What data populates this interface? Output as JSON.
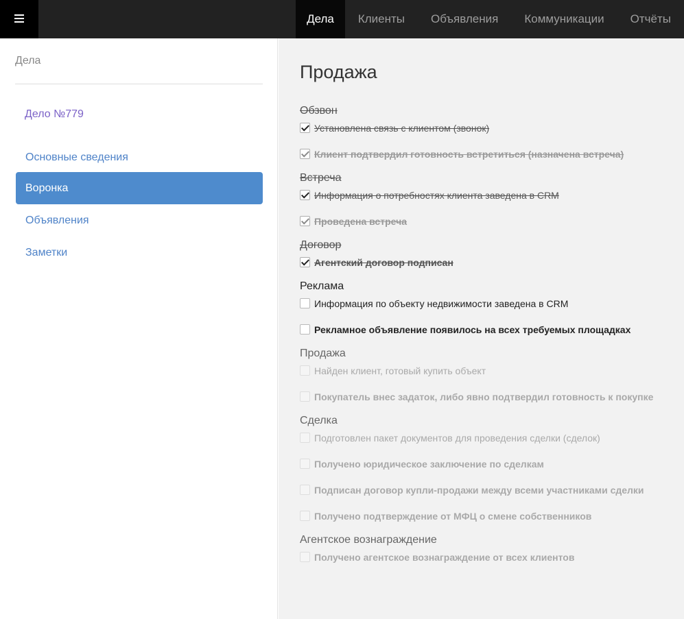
{
  "topbar": {
    "nav": [
      {
        "label": "Дела",
        "active": true
      },
      {
        "label": "Клиенты",
        "active": false
      },
      {
        "label": "Объявления",
        "active": false
      },
      {
        "label": "Коммуникации",
        "active": false
      },
      {
        "label": "Отчёты",
        "active": false
      }
    ]
  },
  "sidebar": {
    "header": "Дела",
    "case_link": "Дело №779",
    "items": [
      {
        "label": "Основные сведения",
        "active": false
      },
      {
        "label": "Воронка",
        "active": true
      },
      {
        "label": "Объявления",
        "active": false
      },
      {
        "label": "Заметки",
        "active": false
      }
    ]
  },
  "main": {
    "title": "Продажа",
    "stages": [
      {
        "title": "Обзвон",
        "state": "done",
        "tasks": [
          {
            "label": "Установлена связь с клиентом (звонок)",
            "checked": true,
            "bold": false,
            "soft": false
          },
          {
            "label": "Клиент подтвердил готовность встретиться (назначена встреча)",
            "checked": true,
            "bold": true,
            "soft": true
          }
        ]
      },
      {
        "title": "Встреча",
        "state": "done",
        "tasks": [
          {
            "label": "Информация о потребностях клиента заведена в CRM",
            "checked": true,
            "bold": false,
            "soft": false
          },
          {
            "label": "Проведена встреча",
            "checked": true,
            "bold": true,
            "soft": true
          }
        ]
      },
      {
        "title": "Договор",
        "state": "done",
        "tasks": [
          {
            "label": "Агентский договор подписан",
            "checked": true,
            "bold": true,
            "soft": false
          }
        ]
      },
      {
        "title": "Реклама",
        "state": "current",
        "tasks": [
          {
            "label": "Информация по объекту недвижимости заведена в CRM",
            "checked": false,
            "bold": false,
            "soft": false
          },
          {
            "label": "Рекламное объявление появилось на всех требуемых площадках",
            "checked": false,
            "bold": true,
            "soft": false
          }
        ]
      },
      {
        "title": "Продажа",
        "state": "future",
        "tasks": [
          {
            "label": "Найден клиент, готовый купить объект",
            "checked": false,
            "bold": false,
            "soft": false
          },
          {
            "label": "Покупатель внес задаток, либо явно подтвердил готовность к покупке",
            "checked": false,
            "bold": true,
            "soft": false
          }
        ]
      },
      {
        "title": "Сделка",
        "state": "future",
        "tasks": [
          {
            "label": "Подготовлен пакет документов для проведения сделки (сделок)",
            "checked": false,
            "bold": false,
            "soft": false
          },
          {
            "label": "Получено юридическое заключение по сделкам",
            "checked": false,
            "bold": true,
            "soft": false
          },
          {
            "label": "Подписан договор купли-продажи между всеми участниками сделки",
            "checked": false,
            "bold": true,
            "soft": false
          },
          {
            "label": "Получено подтверждение от МФЦ о смене собственников",
            "checked": false,
            "bold": true,
            "soft": false
          }
        ]
      },
      {
        "title": "Агентское вознаграждение",
        "state": "future",
        "tasks": [
          {
            "label": "Получено агентское вознаграждение от всех клиентов",
            "checked": false,
            "bold": true,
            "soft": false
          }
        ]
      }
    ]
  }
}
